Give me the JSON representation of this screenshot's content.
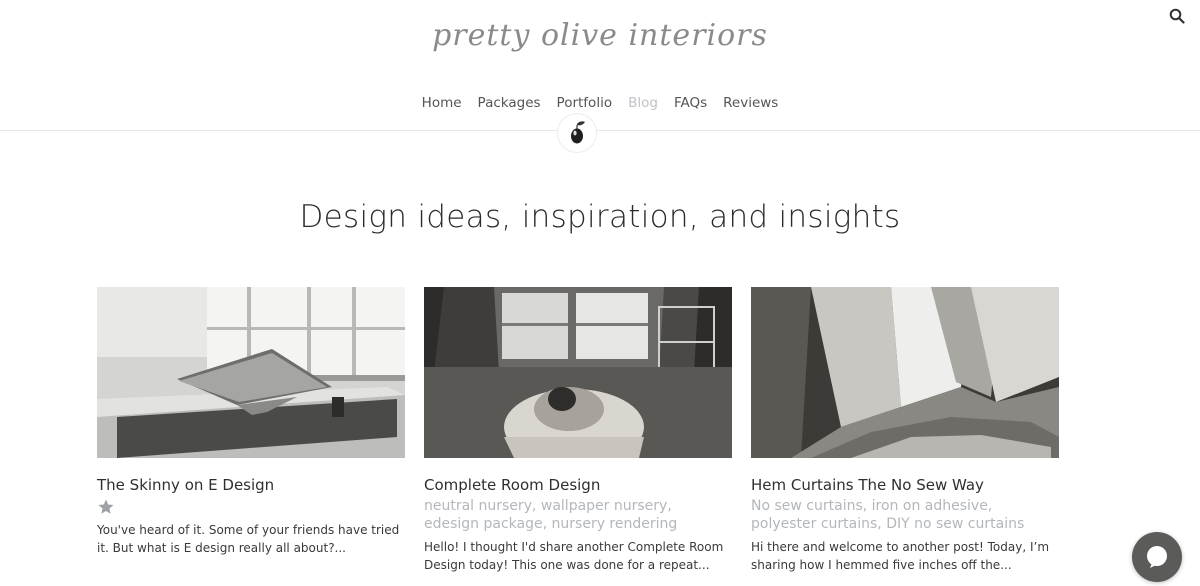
{
  "brand": {
    "logo_text": "pretty olive interiors"
  },
  "nav": {
    "items": [
      {
        "label": "Home"
      },
      {
        "label": "Packages"
      },
      {
        "label": "Portfolio"
      },
      {
        "label": "Blog"
      },
      {
        "label": "FAQs"
      },
      {
        "label": "Reviews"
      }
    ],
    "active_index": 3
  },
  "page": {
    "heading": "Design ideas, inspiration, and insights"
  },
  "posts": [
    {
      "title": "The Skinny on E Design",
      "tags": [],
      "excerpt": "You've heard of it. Some of your friends have tried it. But what is E design really all about?..."
    },
    {
      "title": "Complete Room Design",
      "tags": [
        "neutral nursery",
        "wallpaper nursery",
        "edesign package",
        "nursery rendering"
      ],
      "excerpt": "Hello! I thought I'd share another Complete Room Design today! This one was done for a repeat..."
    },
    {
      "title": "Hem Curtains The No Sew Way",
      "tags": [
        "No sew curtains",
        "iron on adhesive",
        "polyester curtains",
        "DIY no sew curtains"
      ],
      "excerpt": "Hi there and welcome to another post! Today, I’m sharing how I hemmed five inches off the..."
    }
  ],
  "colors": {
    "nav_active": "#bfc3c8",
    "tag_text": "#b3b7bc",
    "chat_button": "#5b5b59"
  },
  "icons": {
    "search": "search-icon",
    "olive": "olive-icon",
    "star": "star-icon",
    "chat": "chat-icon"
  }
}
